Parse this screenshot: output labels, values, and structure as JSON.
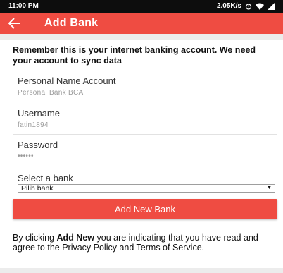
{
  "status_bar": {
    "time": "11:00 PM",
    "network_speed": "2.05K/s"
  },
  "app_bar": {
    "title": "Add Bank",
    "back_icon": "arrow-left-icon",
    "color": "#ef4c42"
  },
  "intro_text": "Remember this is your internet banking account. We need your account to sync data",
  "fields": [
    {
      "label": "Personal Name Account",
      "value": "Personal Bank BCA"
    },
    {
      "label": "Username",
      "value": "fatin1894"
    },
    {
      "label": "Password",
      "value": "••••••"
    }
  ],
  "bank_select": {
    "label": "Select a bank",
    "selected": "Pilih bank"
  },
  "add_button": {
    "label": "Add New Bank"
  },
  "terms": {
    "prefix": "By clicking ",
    "emphasis": "Add New",
    "suffix": " you are indicating that you have read and agree to the Privacy Policy and Terms of Service."
  }
}
